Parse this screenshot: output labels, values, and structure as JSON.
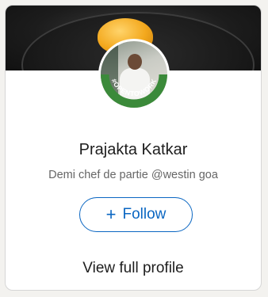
{
  "profile_card": {
    "name": "Prajakta Katkar",
    "headline": "Demi chef de partie @westin goa",
    "avatar_badge": "#OPENTOWORK",
    "follow_label": "Follow",
    "follow_icon": "plus-icon",
    "view_profile_label": "View full profile"
  },
  "colors": {
    "accent": "#0a66c2",
    "open_to_work_green": "#3b8a3a",
    "text_primary": "#1d1d1d",
    "text_secondary": "#666666"
  }
}
